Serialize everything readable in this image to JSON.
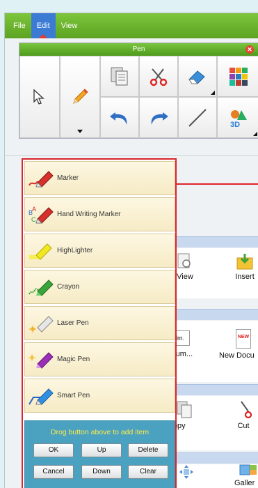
{
  "menu": {
    "items": [
      "File",
      "Edit",
      "View"
    ]
  },
  "pen_panel": {
    "title": "Pen",
    "close_symbol": "✕"
  },
  "tools": [
    {
      "name": "select-arrow-icon"
    },
    {
      "name": "pencil-icon"
    },
    {
      "name": "copy-pages-icon"
    },
    {
      "name": "scissors-icon"
    },
    {
      "name": "eraser-icon"
    },
    {
      "name": "color-palette-icon"
    },
    {
      "name": "undo-icon"
    },
    {
      "name": "redo-icon"
    },
    {
      "name": "line-icon"
    },
    {
      "name": "3d-shapes-icon"
    }
  ],
  "background": {
    "row1": [
      "View",
      "Insert"
    ],
    "row2": [
      "t Docum...",
      "New Docu"
    ],
    "row2_badges": [
      "lm.",
      "NEW"
    ],
    "row3": [
      "Copy",
      "Cut"
    ],
    "row4": [
      "Galler"
    ]
  },
  "pens": [
    {
      "label": "Marker",
      "icon": "marker-icon"
    },
    {
      "label": "Hand Writing Marker",
      "icon": "hand-writing-marker-icon"
    },
    {
      "label": "HighLighter",
      "icon": "highlighter-icon"
    },
    {
      "label": "Crayon",
      "icon": "crayon-icon"
    },
    {
      "label": "Laser Pen",
      "icon": "laser-pen-icon"
    },
    {
      "label": "Magic Pen",
      "icon": "magic-pen-icon"
    },
    {
      "label": "Smart Pen",
      "icon": "smart-pen-icon"
    }
  ],
  "actions": {
    "hint": "Drog button above to add item",
    "ok": "OK",
    "up": "Up",
    "delete": "Delete",
    "cancel": "Cancel",
    "down": "Down",
    "clear": "Clear"
  },
  "colors": {
    "menu_green": "#6bb42e",
    "accent_red": "#d9262c",
    "action_blue": "#4aa2c0",
    "hint_yellow": "#ffe94a"
  }
}
